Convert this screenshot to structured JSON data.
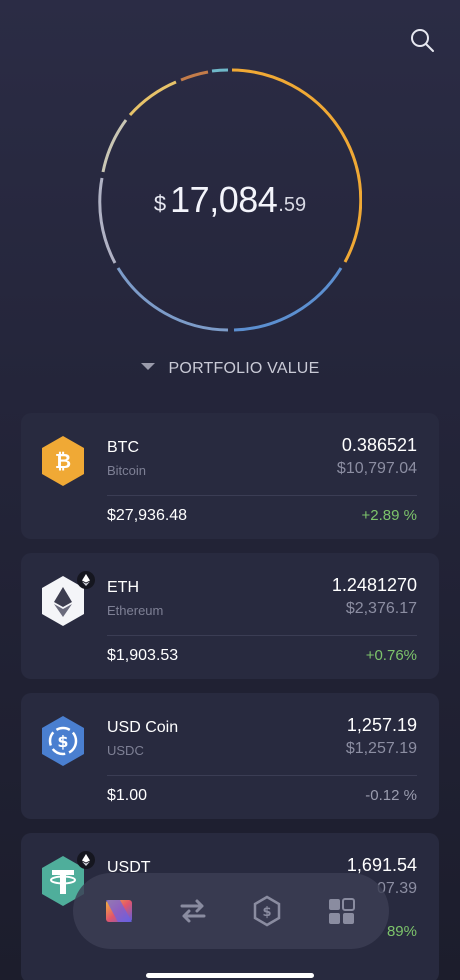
{
  "portfolio": {
    "currency_symbol": "$",
    "value_integer": "17,084",
    "value_decimal": ".59",
    "label": "PORTFOLIO VALUE",
    "ring_colors": [
      "#f0a935",
      "#5c8fd0",
      "#9fb7d8",
      "#b0b2c4",
      "#e7c36a",
      "#c37c4a",
      "#6fb8c9"
    ]
  },
  "assets": [
    {
      "symbol": "BTC",
      "name": "Bitcoin",
      "amount": "0.386521",
      "value": "$10,797.04",
      "price": "$27,936.48",
      "change": "+2.89 %",
      "change_dir": "positive",
      "icon": "bitcoin-icon",
      "color": "#f0a935"
    },
    {
      "symbol": "ETH",
      "name": "Ethereum",
      "amount": "1.2481270",
      "value": "$2,376.17",
      "price": "$1,903.53",
      "change": "+0.76%",
      "change_dir": "positive",
      "icon": "ethereum-icon",
      "color": "#ffffff"
    },
    {
      "symbol": "USD Coin",
      "name": "USDC",
      "amount": "1,257.19",
      "value": "$1,257.19",
      "price": "$1.00",
      "change": "-0.12 %",
      "change_dir": "negative",
      "icon": "usdc-icon",
      "color": "#4a7fd0"
    },
    {
      "symbol": "USDT",
      "name": "",
      "amount": "1,691.54",
      "value": "07.39",
      "price": "",
      "change": "89%",
      "change_dir": "positive",
      "icon": "tether-icon",
      "color": "#4fae9b"
    }
  ],
  "nav": {
    "items": [
      "wallet-icon",
      "exchange-icon",
      "staking-icon",
      "apps-grid-icon"
    ]
  }
}
